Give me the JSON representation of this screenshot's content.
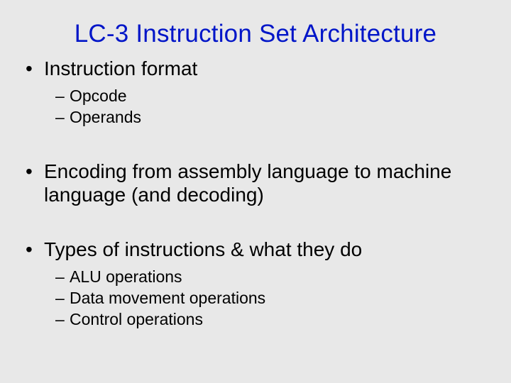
{
  "title": "LC-3 Instruction Set Architecture",
  "bullets": [
    {
      "text": "Instruction format",
      "sub": [
        "Opcode",
        "Operands"
      ]
    },
    {
      "text": "Encoding from assembly language to machine language (and decoding)",
      "sub": []
    },
    {
      "text": "Types of instructions & what they do",
      "sub": [
        "ALU operations",
        "Data movement operations",
        "Control operations"
      ]
    }
  ]
}
